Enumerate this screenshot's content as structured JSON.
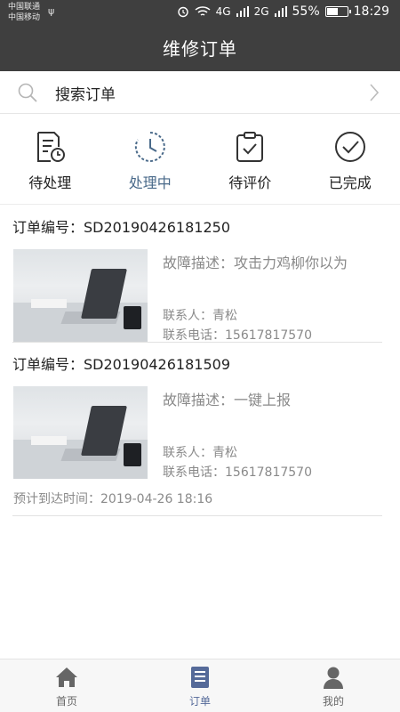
{
  "status_bar": {
    "carrier_1": "中国联通",
    "carrier_2": "中国移动",
    "signal_4g": "4G",
    "signal_2g": "2G",
    "battery": "55%",
    "battery_level": 0.55,
    "time": "18:29"
  },
  "header": {
    "title": "维修订单"
  },
  "search": {
    "label": "搜索订单"
  },
  "tabs": [
    {
      "label": "待处理",
      "icon": "pending-icon"
    },
    {
      "label": "处理中",
      "icon": "processing-clock-icon",
      "active": true
    },
    {
      "label": "待评价",
      "icon": "review-clipboard-icon"
    },
    {
      "label": "已完成",
      "icon": "check-circle-icon"
    }
  ],
  "orders": [
    {
      "order_no": "订单编号：SD20190426181250",
      "fault": "故障描述：攻击力鸡柳你以为",
      "contact": "联系人：青松",
      "phone": "联系电话：15617817570"
    },
    {
      "order_no": "订单编号：SD20190426181509",
      "fault": "故障描述：一键上报",
      "contact": "联系人：青松",
      "phone": "联系电话：15617817570",
      "eta": "预计到达时间：2019-04-26 18:16"
    }
  ],
  "bottom_nav": [
    {
      "label": "首页",
      "icon": "home-icon"
    },
    {
      "label": "订单",
      "icon": "order-list-icon",
      "active": true
    },
    {
      "label": "我的",
      "icon": "user-icon"
    }
  ],
  "colors": {
    "header_bg": "#3f3f3f",
    "active_tab": "#4a6a8a",
    "nav_active": "#556a99",
    "muted_text": "#8a8a8a"
  }
}
